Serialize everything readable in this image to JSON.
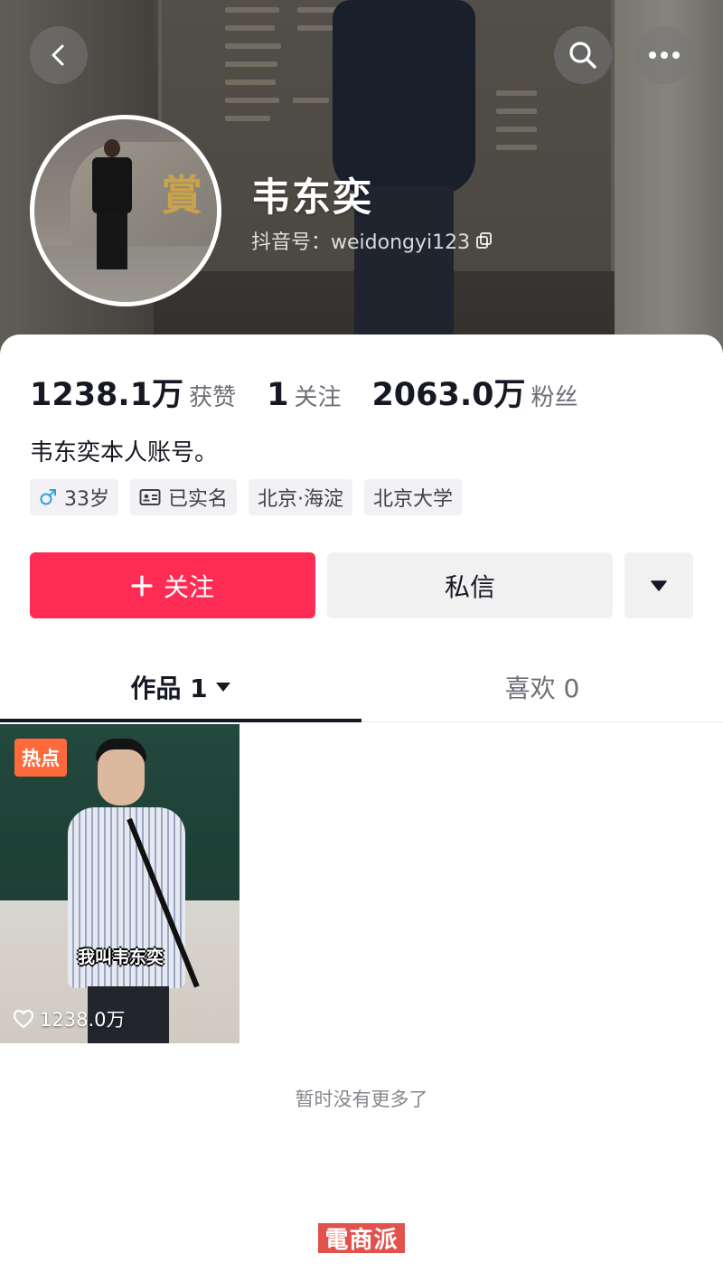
{
  "header": {
    "nickname": "韦东奕",
    "douyin_id": "抖音号：weidongyi123"
  },
  "icons": {
    "back": "chevron-left-icon",
    "search": "search-icon",
    "more": "more-horizontal-icon",
    "copy": "copy-icon",
    "gender": "male-icon",
    "verified": "id-card-icon",
    "plus": "plus-icon",
    "dropdown": "caret-down-icon",
    "heart": "heart-outline-icon"
  },
  "stats": [
    {
      "num": "1238.1万",
      "label": "获赞"
    },
    {
      "num": "1",
      "label": "关注"
    },
    {
      "num": "2063.0万",
      "label": "粉丝"
    }
  ],
  "bio": "韦东奕本人账号。",
  "tags": {
    "age": "33岁",
    "verified": "已实名",
    "location": "北京·海淀",
    "school": "北京大学"
  },
  "actions": {
    "follow": "关注",
    "message": "私信"
  },
  "tabs": {
    "works": "作品 1",
    "likes": "喜欢 0"
  },
  "video": {
    "badge": "热点",
    "subtitle": "我叫韦东奕",
    "likes": "1238.0万"
  },
  "footer": {
    "no_more": "暂时没有更多了",
    "watermark": "電商派"
  },
  "colors": {
    "accent": "#fe2c55",
    "hot_badge": "#ff6a3d",
    "watermark": "#e2514b"
  }
}
